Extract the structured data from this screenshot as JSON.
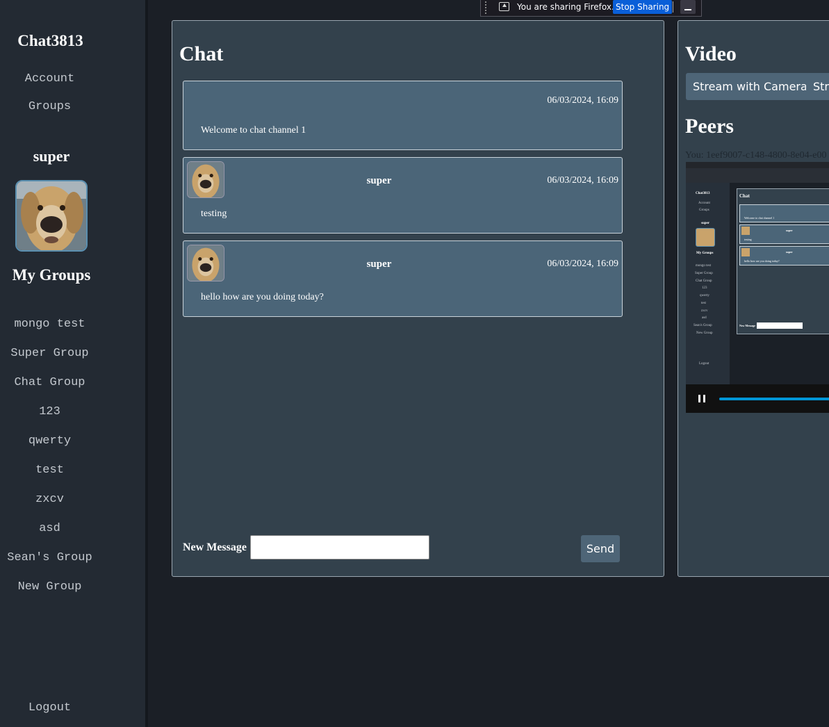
{
  "sidebar": {
    "brand": "Chat3813",
    "nav": [
      "Account",
      "Groups"
    ],
    "username": "super",
    "my_groups_title": "My Groups",
    "groups": [
      "mongo test",
      "Super Group",
      "Chat Group",
      "123",
      "qwerty",
      "test",
      "zxcv",
      "asd",
      "Sean's Group",
      "New Group"
    ],
    "logout": "Logout"
  },
  "sharebar": {
    "text": "You are sharing Firefox.",
    "stop_label": "Stop Sharing"
  },
  "chat": {
    "title": "Chat",
    "messages": [
      {
        "sender": "",
        "time": "06/03/2024, 16:09",
        "text": "Welcome to chat channel 1"
      },
      {
        "sender": "super",
        "time": "06/03/2024, 16:09",
        "text": "testing"
      },
      {
        "sender": "super",
        "time": "06/03/2024, 16:09",
        "text": "hello how are you doing today?"
      }
    ],
    "new_message_label": "New Message",
    "input_value": "",
    "send_label": "Send"
  },
  "video": {
    "title": "Video",
    "stream_camera_label": "Stream with Camera",
    "stream_screen_label": "Stre",
    "peers_title": "Peers",
    "peer_id": "You: 1eef9007-c148-4800-8e04-e00",
    "preview": {
      "brand": "Chat3813",
      "nav": [
        "Account",
        "Groups"
      ],
      "username": "super",
      "my_groups_title": "My Groups",
      "groups": [
        "mongo test",
        "Super Group",
        "Chat Group",
        "123",
        "qwerty",
        "test",
        "zxcv",
        "asd",
        "Sean's Group",
        "New Group"
      ],
      "logout": "Logout",
      "chat_title": "Chat",
      "welcome": "Welcome to chat channel 1",
      "sender": "super",
      "msg1": "testing",
      "msg2": "hello how are you doing today?",
      "new_message_label": "New Message"
    }
  },
  "colors": {
    "sidebar_bg": "#232a33",
    "page_bg": "#1b1f26",
    "panel_bg": "#33414c",
    "message_bg": "#4b6578",
    "button_bg": "#4e6577",
    "share_accent": "#0a5fd8",
    "progress": "#0096d6"
  },
  "icons": {
    "share": "share-screen-icon",
    "pause": "pause-icon",
    "grip": "drag-grip-icon",
    "minimize": "minimize-icon"
  }
}
